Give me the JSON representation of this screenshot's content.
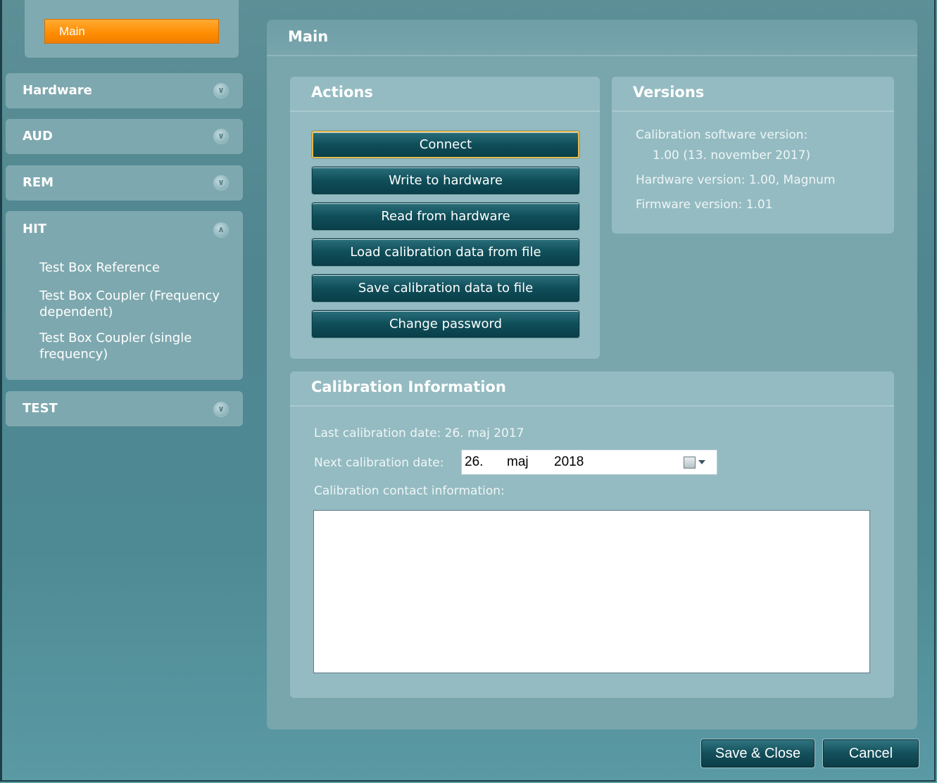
{
  "sidebar": {
    "main_label": "Main",
    "groups": [
      {
        "title": "Hardware",
        "expanded": false,
        "items": []
      },
      {
        "title": "AUD",
        "expanded": false,
        "items": []
      },
      {
        "title": "REM",
        "expanded": false,
        "items": []
      },
      {
        "title": "HIT",
        "expanded": true,
        "items": [
          {
            "label": "Test Box Reference"
          },
          {
            "label": "Test Box Coupler (Frequency dependent)"
          },
          {
            "label": "Test Box Coupler (single frequency)"
          }
        ]
      },
      {
        "title": "TEST",
        "expanded": false,
        "items": []
      }
    ]
  },
  "main": {
    "title": "Main",
    "actions": {
      "title": "Actions",
      "buttons": [
        "Connect",
        "Write to hardware",
        "Read from hardware",
        "Load calibration data from file",
        "Save calibration data to file",
        "Change password"
      ]
    },
    "versions": {
      "title": "Versions",
      "calibration_software_label": "Calibration software version:",
      "calibration_software_value": "1.00  (13. november 2017)",
      "hardware": "Hardware version: 1.00, Magnum",
      "firmware": "Firmware version: 1.01"
    },
    "calibration": {
      "title": "Calibration Information",
      "last_date": "Last calibration date: 26. maj 2017",
      "next_label": "Next calibration date:",
      "next_day": "26.",
      "next_month": "maj",
      "next_year": "2018",
      "contact_label": "Calibration contact information:",
      "contact_value": ""
    }
  },
  "footer": {
    "save_close": "Save & Close",
    "cancel": "Cancel"
  },
  "colors": {
    "accent_orange": "#ff8c00",
    "button_teal": "#0f4e59",
    "background": "#4f8690"
  }
}
